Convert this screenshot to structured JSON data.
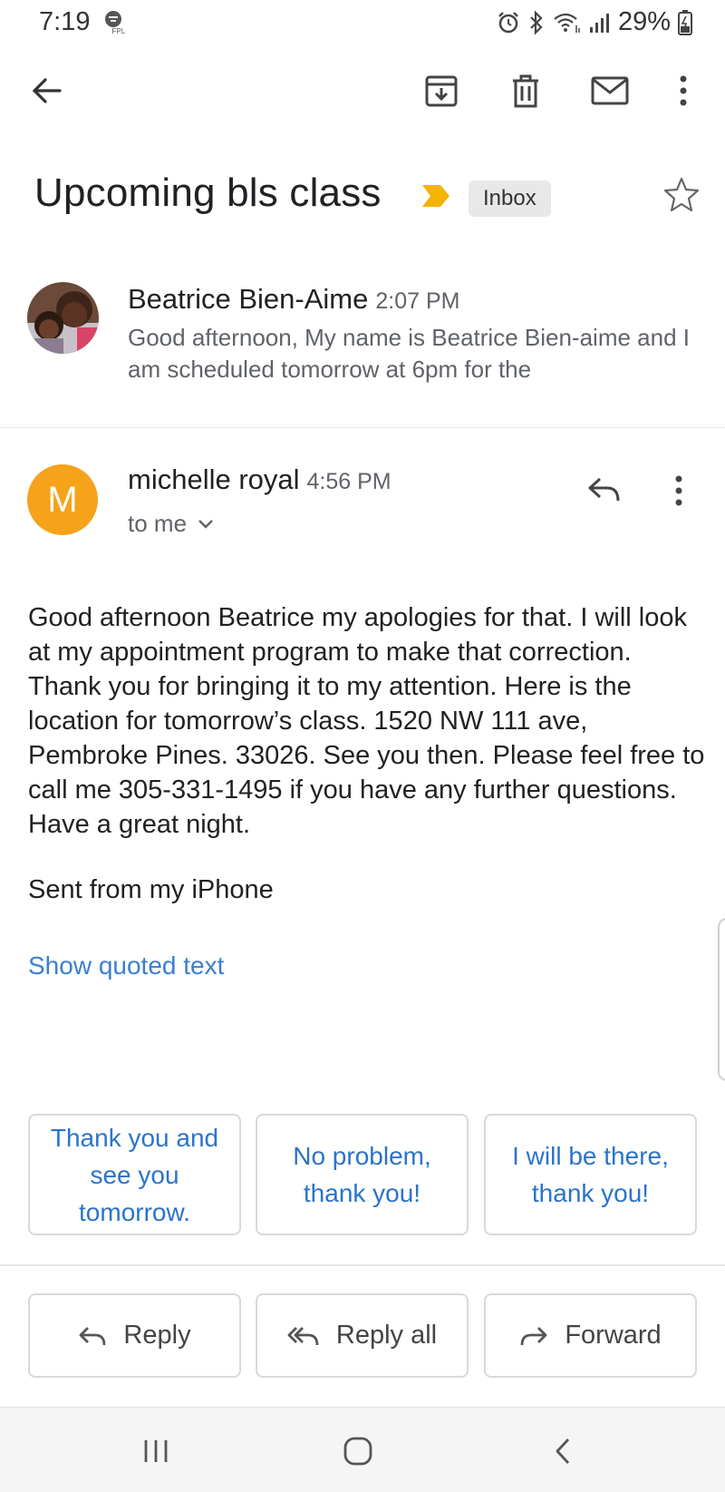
{
  "status_bar": {
    "time": "7:19",
    "carrier_badge": "FPL",
    "battery": "29%"
  },
  "toolbar": {
    "icons": [
      "back-arrow-icon",
      "archive-icon",
      "delete-icon",
      "mark-unread-icon",
      "more-vert-icon"
    ]
  },
  "thread": {
    "subject": "Upcoming bls class",
    "label": "Inbox",
    "importance_color": "#f4b400"
  },
  "messages": [
    {
      "sender": "Beatrice Bien-Aime",
      "time": "2:07 PM",
      "snippet": "Good afternoon, My name is Beatrice Bien-aime and I am scheduled tomorrow at 6pm for the"
    },
    {
      "sender": "michelle royal",
      "avatar_letter": "M",
      "avatar_color": "#f6a21a",
      "time": "4:56 PM",
      "recipient": "to me",
      "body": "Good afternoon Beatrice my apologies for that. I will look at my appointment program to make that correction. Thank you for bringing it to my attention. Here is the location for tomorrow’s class. 1520 NW 111 ave, Pembroke Pines. 33026. See you then. Please feel free to call me 305-331-1495 if you have any further questions. Have a great night.",
      "signature": "Sent from my iPhone",
      "show_quoted": "Show quoted text"
    }
  ],
  "smart_replies": [
    "Thank you and see you tomorrow.",
    "No problem, thank you!",
    "I will be there, thank you!"
  ],
  "actions": {
    "reply": "Reply",
    "reply_all": "Reply all",
    "forward": "Forward"
  },
  "accent_link_color": "#3b7fd1"
}
